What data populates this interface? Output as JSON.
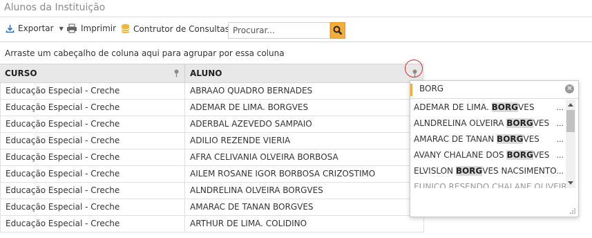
{
  "window": {
    "title": "Alunos da Instituição"
  },
  "toolbar": {
    "export_label": "Exportar",
    "print_label": "Imprimir",
    "query_builder_label": "Contrutor de Consultas",
    "search_placeholder": "Procurar..."
  },
  "grouping_hint": "Arraste um cabeçalho de coluna aqui para agrupar por essa coluna",
  "grid": {
    "columns": [
      "CURSO",
      "ALUNO"
    ],
    "rows": [
      [
        "Educação Especial - Creche",
        "ABRAAO QUADRO BERNADES"
      ],
      [
        "Educação Especial - Creche",
        "ADEMAR DE LIMA. BORGVES"
      ],
      [
        "Educação Especial - Creche",
        "ADERBAL AZEVEDO SAMPAIO"
      ],
      [
        "Educação Especial - Creche",
        "ADILIO REZENDE VIERIA"
      ],
      [
        "Educação Especial - Creche",
        "AFRA CELIVANIA OLVEIRA BORBOSA"
      ],
      [
        "Educação Especial - Creche",
        "AILEM ROSANE IGOR BORBOSA CRIZOSTIMO"
      ],
      [
        "Educação Especial - Creche",
        "ALNDRELINA OLVEIRA BORGVES"
      ],
      [
        "Educação Especial - Creche",
        "AMARAC DE TANAN BORGVES"
      ],
      [
        "Educação Especial - Creche",
        "ARTHUR DE LIMA. COLIDINO"
      ]
    ]
  },
  "filter_popup": {
    "search_value": "BORG",
    "items": [
      {
        "before": "ADEMAR DE LIMA. ",
        "match": "BORG",
        "after": "VES"
      },
      {
        "before": "ALNDRELINA OLVEIRA ",
        "match": "BORG",
        "after": "VES"
      },
      {
        "before": "AMARAC DE TANAN ",
        "match": "BORG",
        "after": "VES"
      },
      {
        "before": "AVANY CHALANE DOS ",
        "match": "BORG",
        "after": "VES"
      },
      {
        "before": "ELVISLON ",
        "match": "BORG",
        "after": "VES NACSIMENTO"
      },
      {
        "before": "EUNICO RESENDO CHALANE OLIVEIRA",
        "match": "",
        "after": ""
      }
    ],
    "item_more": "..."
  },
  "colors": {
    "accent": "#f3ad38",
    "highlight": "#d9d9d9",
    "annotation": "#d32f2f"
  }
}
